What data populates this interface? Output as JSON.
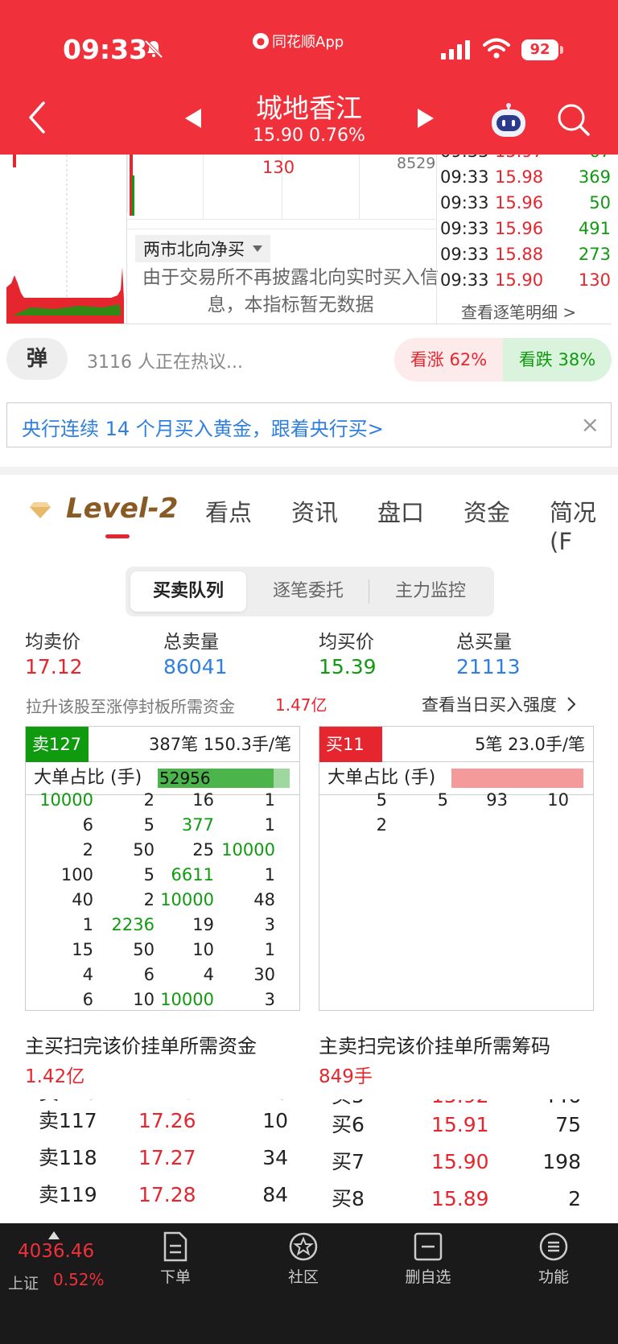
{
  "status_bar": {
    "time": "09:33",
    "app_name": "同花顺App",
    "battery": "92"
  },
  "header": {
    "stock_name": "城地香江",
    "price_change": "15.90 0.76%"
  },
  "chart": {
    "label_130": "130",
    "label_8529": "8529",
    "north_select": "两市北向净买",
    "north_message": "由于交易所不再披露北向实时买入信息，本指标暂无数据"
  },
  "trades": {
    "rows": [
      {
        "time": "09:33",
        "price": "15.98",
        "vol": "369"
      },
      {
        "time": "09:33",
        "price": "15.96",
        "vol": "50"
      },
      {
        "time": "09:33",
        "price": "15.96",
        "vol": "491"
      },
      {
        "time": "09:33",
        "price": "15.88",
        "vol": "273"
      },
      {
        "time": "09:33",
        "price": "15.90",
        "vol": "130"
      }
    ],
    "detail_link": "查看逐笔明细 >"
  },
  "discussion": {
    "bullet_label": "弹",
    "text": "3116 人正在热议...",
    "up": "看涨 62%",
    "down": "看跌 38%"
  },
  "promo": {
    "text": "央行连续 14 个月买入黄金，跟着央行买>",
    "close": "×"
  },
  "tabs": {
    "level2": "Level-2",
    "items": [
      "看点",
      "资讯",
      "盘口",
      "资金",
      "简况(F"
    ]
  },
  "segmented": {
    "items": [
      "买卖队列",
      "逐笔委托",
      "主力监控"
    ]
  },
  "summary": {
    "avg_sell_label": "均卖价",
    "avg_sell": "17.12",
    "total_sell_label": "总卖量",
    "total_sell": "86041",
    "avg_buy_label": "均买价",
    "avg_buy": "15.39",
    "total_buy_label": "总买量",
    "total_buy": "21113",
    "funds_note": "拉升该股至涨停封板所需资金",
    "funds_value": "1.47亿",
    "strength_link": "查看当日买入强度"
  },
  "sell_queue": {
    "tag": "卖127",
    "info": "387笔   150.3手/笔",
    "big_label": "大单占比 (手)",
    "big_value": "52956",
    "big_ratio": 0.88,
    "rows": [
      [
        {
          "v": "10000",
          "c": "green"
        },
        {
          "v": "2"
        },
        {
          "v": "16"
        },
        {
          "v": "1"
        }
      ],
      [
        {
          "v": "6"
        },
        {
          "v": "5"
        },
        {
          "v": "377",
          "c": "green"
        },
        {
          "v": "1"
        }
      ],
      [
        {
          "v": "2"
        },
        {
          "v": "50"
        },
        {
          "v": "25"
        },
        {
          "v": "10000",
          "c": "green"
        }
      ],
      [
        {
          "v": "100"
        },
        {
          "v": "5"
        },
        {
          "v": "6611",
          "c": "green"
        },
        {
          "v": "1"
        }
      ],
      [
        {
          "v": "40"
        },
        {
          "v": "2"
        },
        {
          "v": "10000",
          "c": "green"
        },
        {
          "v": "48"
        }
      ],
      [
        {
          "v": "1"
        },
        {
          "v": "2236",
          "c": "green"
        },
        {
          "v": "19"
        },
        {
          "v": "3"
        }
      ],
      [
        {
          "v": "15"
        },
        {
          "v": "50"
        },
        {
          "v": "10"
        },
        {
          "v": "1"
        }
      ],
      [
        {
          "v": "4"
        },
        {
          "v": "6"
        },
        {
          "v": "4"
        },
        {
          "v": "30"
        }
      ],
      [
        {
          "v": "6"
        },
        {
          "v": "10"
        },
        {
          "v": "10000",
          "c": "green"
        },
        {
          "v": "3"
        }
      ]
    ]
  },
  "buy_queue": {
    "tag": "买11",
    "info": "5笔   23.0手/笔",
    "big_label": "大单占比 (手)",
    "rows": [
      [
        {
          "v": "5"
        },
        {
          "v": "5"
        },
        {
          "v": "93"
        },
        {
          "v": "10"
        }
      ],
      [
        {
          "v": "2"
        },
        {
          "v": ""
        },
        {
          "v": ""
        },
        {
          "v": ""
        }
      ]
    ]
  },
  "sweep": {
    "buy_label": "主买扫完该价挂单所需资金",
    "buy_value": "1.42亿",
    "sell_label": "主卖扫完该价挂单所需筹码",
    "sell_value": "849手"
  },
  "book": {
    "asks": [
      {
        "label": "卖117",
        "price": "17.26",
        "vol": "10"
      },
      {
        "label": "卖118",
        "price": "17.27",
        "vol": "34"
      },
      {
        "label": "卖119",
        "price": "17.28",
        "vol": "84"
      }
    ],
    "bids": [
      {
        "label": "买6",
        "price": "15.91",
        "vol": "75"
      },
      {
        "label": "买7",
        "price": "15.90",
        "vol": "198"
      },
      {
        "label": "买8",
        "price": "15.89",
        "vol": "2"
      }
    ]
  },
  "bottom_bar": {
    "index_value": "4036.46",
    "index_name": "上证",
    "index_pct": "0.52%",
    "items": [
      "下单",
      "社区",
      "删自选",
      "功能"
    ]
  }
}
